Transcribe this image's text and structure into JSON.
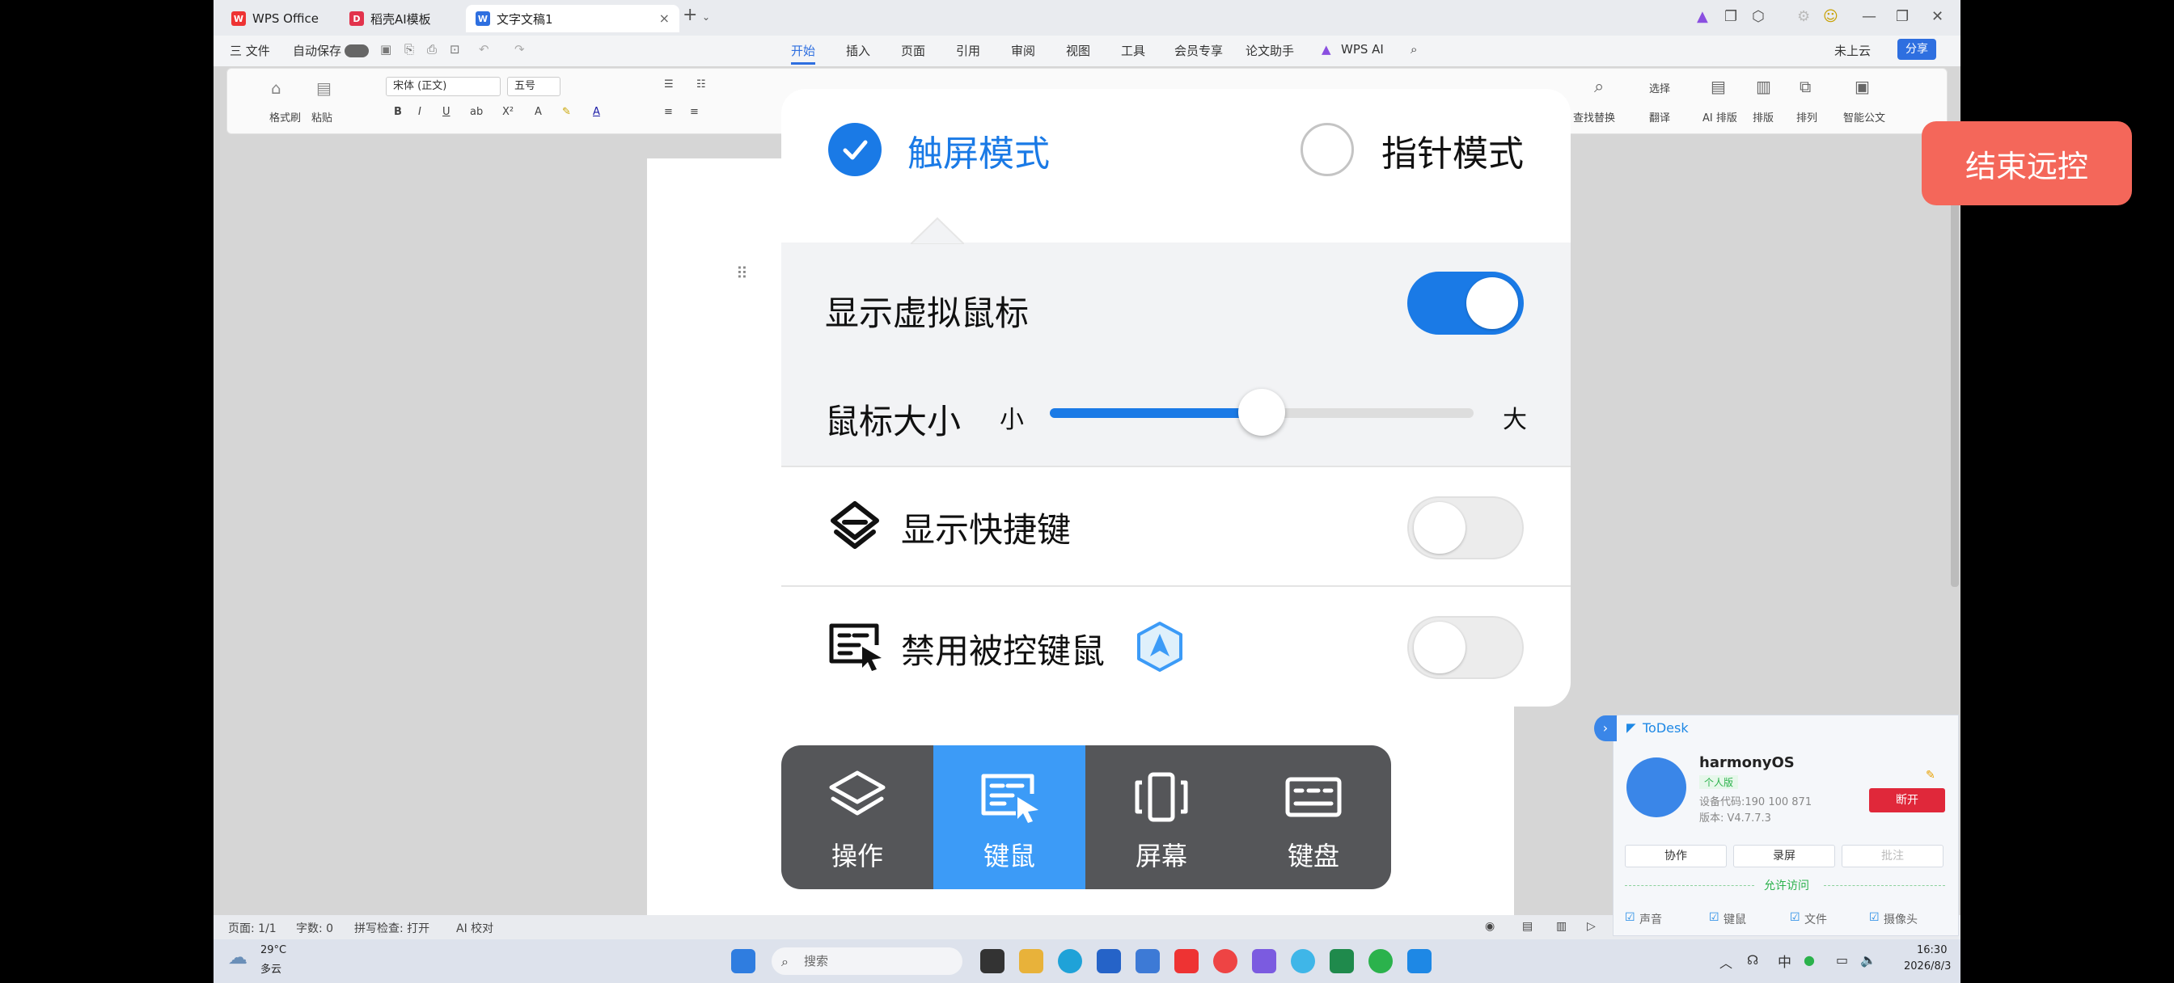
{
  "wps": {
    "tabs": [
      {
        "label": "WPS Office"
      },
      {
        "label": "稻壳AI模板"
      },
      {
        "label": "文字文稿1"
      }
    ],
    "menu": {
      "file": "三 文件",
      "autosave": "自动保存",
      "items": [
        "开始",
        "插入",
        "页面",
        "引用",
        "审阅",
        "视图",
        "工具",
        "会员专享",
        "论文助手",
        "WPS AI"
      ],
      "cloud": "未上云",
      "share": "分享"
    },
    "ribbon": {
      "format_painter": "格式刷",
      "paste": "粘贴",
      "font": "宋体 (正文)",
      "size": "五号",
      "find_replace": "查找替换",
      "select": "选择",
      "translate": "翻译",
      "ai_layout": "AI 排版",
      "layout": "排版",
      "arrange": "排列",
      "smart_doc": "智能公文"
    },
    "status": {
      "page": "页面: 1/1",
      "words": "字数: 0",
      "spellcheck": "拼写检查: 打开",
      "ai_proof": "AI 校对"
    }
  },
  "taskbar": {
    "weather_temp": "29°C",
    "weather_desc": "多云",
    "search_placeholder": "搜索",
    "ime": "中",
    "time": "16:30",
    "date": "2026/8/3"
  },
  "panel": {
    "touch_mode": "触屏模式",
    "pointer_mode": "指针模式",
    "selected_mode": "touch",
    "show_virtual_mouse": "显示虚拟鼠标",
    "show_virtual_mouse_on": true,
    "mouse_size": "鼠标大小",
    "size_small": "小",
    "size_large": "大",
    "mouse_size_value": 0.5,
    "show_shortcuts": "显示快捷键",
    "show_shortcuts_on": false,
    "disable_controlled_input": "禁用被控键鼠",
    "disable_controlled_input_on": false
  },
  "toolbar": {
    "items": [
      {
        "label": "操作",
        "icon": "layers-icon"
      },
      {
        "label": "键鼠",
        "icon": "keyboard-mouse-icon"
      },
      {
        "label": "屏幕",
        "icon": "screen-rotate-icon"
      },
      {
        "label": "键盘",
        "icon": "keyboard-icon"
      }
    ],
    "active": 1
  },
  "end_remote": "结束远控",
  "todesk": {
    "brand": "ToDesk",
    "device_name": "harmonyOS",
    "edition": "个人版",
    "device_code": "设备代码:190 100 871",
    "version": "版本: V4.7.7.3",
    "disconnect": "断开",
    "collaborate": "协作",
    "record": "录屏",
    "annotate": "批注",
    "allow_access": "允许访问",
    "perms": [
      "声音",
      "键鼠",
      "文件",
      "摄像头"
    ]
  },
  "colors": {
    "accent": "#1a7ae6",
    "active_tool": "#3c9bf7",
    "end_button": "#f4675a",
    "wps_blue": "#2e6fe0"
  }
}
